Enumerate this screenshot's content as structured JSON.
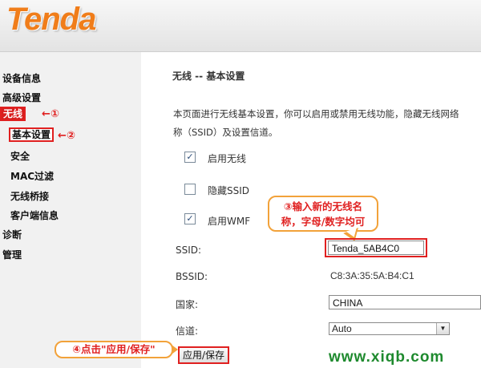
{
  "brand": {
    "logo_text": "Tenda"
  },
  "sidebar": {
    "items": [
      {
        "label": "设备信息"
      },
      {
        "label": "高级设置"
      },
      {
        "label": "无线"
      },
      {
        "label": "基本设置"
      },
      {
        "label": "安全"
      },
      {
        "label": "MAC过滤"
      },
      {
        "label": "无线桥接"
      },
      {
        "label": "客户端信息"
      },
      {
        "label": "诊断"
      },
      {
        "label": "管理"
      }
    ]
  },
  "annotations": {
    "step1": "←①",
    "step2": "←②",
    "step3_line1": "③输入新的无线名",
    "step3_line2": "称，字母/数字均可",
    "step4": "④点击\"应用/保存\""
  },
  "main": {
    "title": "无线 -- 基本设置",
    "description_line1": "本页面进行无线基本设置，你可以启用或禁用无线功能，隐藏无线网络",
    "description_line2": "称（SSID）及设置信道。",
    "checkboxes": [
      {
        "label": "启用无线",
        "checked": true,
        "mark": "✓"
      },
      {
        "label": "隐藏SSID",
        "checked": false,
        "mark": ""
      },
      {
        "label": "启用WMF",
        "checked": true,
        "mark": "✓"
      }
    ],
    "fields": {
      "ssid_label": "SSID:",
      "ssid_value": "Tenda_5AB4C0",
      "bssid_label": "BSSID:",
      "bssid_value": "C8:3A:35:5A:B4:C1",
      "country_label": "国家:",
      "country_value": "CHINA",
      "channel_label": "信道:",
      "channel_value": "Auto"
    },
    "apply_button": "应用/保存"
  },
  "watermark": "www.xiqb.com",
  "colors": {
    "accent_red": "#e02020",
    "bubble_orange": "#f2a23a",
    "logo_orange": "#f07d1a",
    "watermark_green": "#1e8a2e"
  }
}
